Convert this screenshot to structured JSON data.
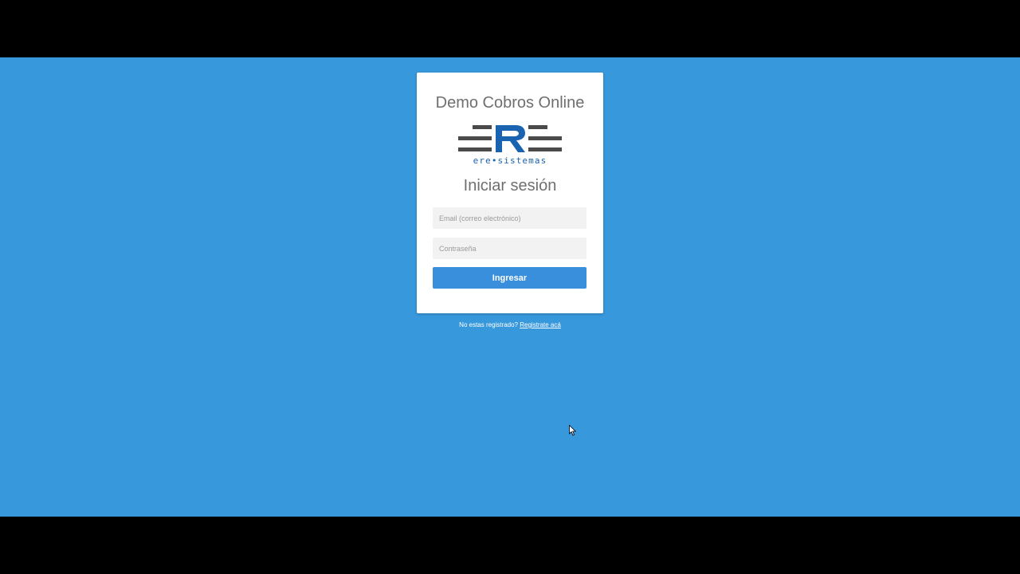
{
  "app": {
    "title": "Demo Cobros Online"
  },
  "logo": {
    "name": "ere-sistemas-logo",
    "caption": "ere•sistemas",
    "colors": {
      "bars": "#4a4a4a",
      "letter": "#1a63b0"
    }
  },
  "login": {
    "heading": "Iniciar sesión",
    "email_placeholder": "Email (correo electrónico)",
    "email_value": "",
    "password_placeholder": "Contraseña",
    "password_value": "",
    "submit_label": "Ingresar"
  },
  "register": {
    "prompt": "No estas registrado?",
    "link_label": "Registrate acá"
  },
  "colors": {
    "background": "#3898dc",
    "button": "#3a8fdd",
    "card": "#ffffff",
    "input": "#f2f2f2",
    "title_text": "#6f6f6f"
  }
}
